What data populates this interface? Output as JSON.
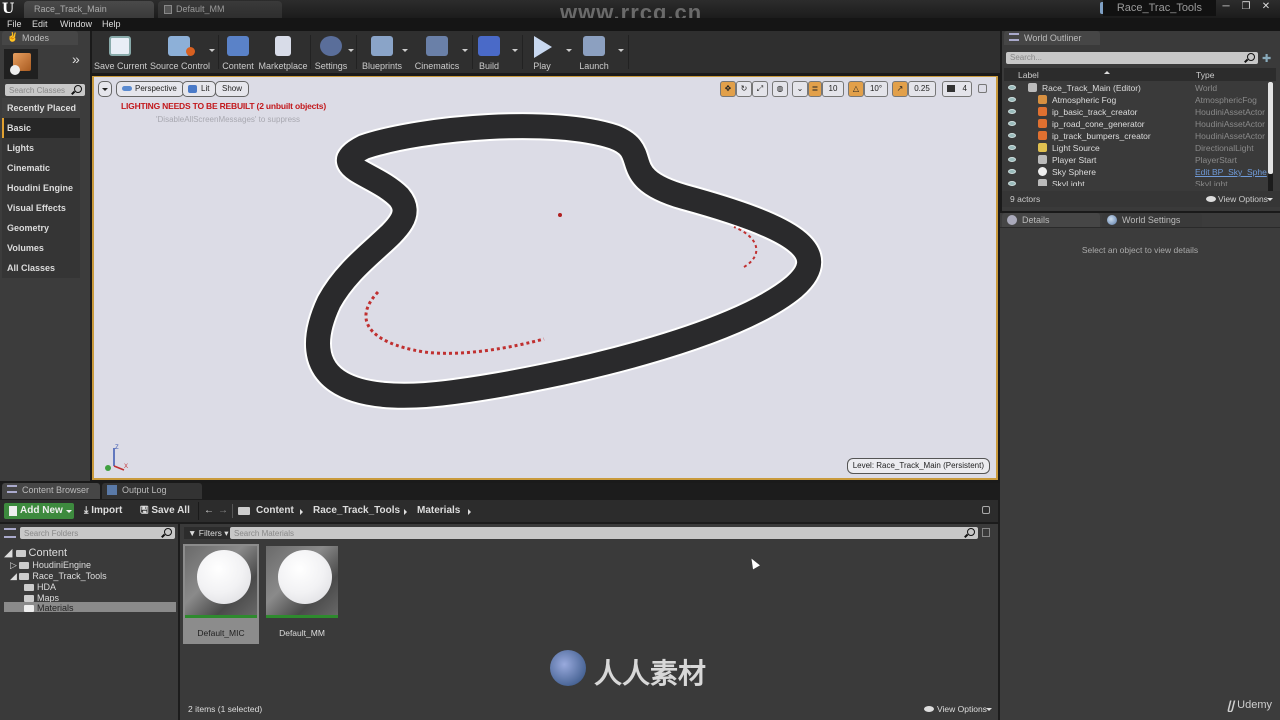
{
  "window": {
    "logo": "U",
    "tabs": [
      {
        "label": "Race_Track_Main",
        "active": true
      },
      {
        "label": "Default_MM",
        "active": false
      }
    ],
    "project_name": "Race_Trac_Tools",
    "controls": {
      "minimize": "─",
      "maximize": "❐",
      "close": "✕"
    }
  },
  "menu": [
    "File",
    "Edit",
    "Window",
    "Help"
  ],
  "modes": {
    "tab_label": "Modes",
    "expand_glyph": "»",
    "search_placeholder": "Search Classes",
    "categories": [
      "Recently Placed",
      "Basic",
      "Lights",
      "Cinematic",
      "Houdini Engine",
      "Visual Effects",
      "Geometry",
      "Volumes",
      "All Classes"
    ],
    "active_category": "Basic"
  },
  "toolbar": {
    "buttons": [
      {
        "label": "Save Current",
        "icon": "save-icon"
      },
      {
        "label": "Source Control",
        "icon": "source-control-icon"
      },
      {
        "label": "Content",
        "icon": "content-icon"
      },
      {
        "label": "Marketplace",
        "icon": "marketplace-icon"
      },
      {
        "label": "Settings",
        "icon": "settings-icon"
      },
      {
        "label": "Blueprints",
        "icon": "blueprints-icon"
      },
      {
        "label": "Cinematics",
        "icon": "cinematics-icon"
      },
      {
        "label": "Build",
        "icon": "build-icon"
      },
      {
        "label": "Play",
        "icon": "play-icon"
      },
      {
        "label": "Launch",
        "icon": "launch-icon"
      }
    ]
  },
  "viewport": {
    "perspective_label": "Perspective",
    "lit_label": "Lit",
    "show_label": "Show",
    "warning": "LIGHTING NEEDS TO BE REBUILT (2 unbuilt objects)",
    "hint": "'DisableAllScreenMessages' to suppress",
    "grid_snap": "10",
    "rotation_snap": "10°",
    "scale_snap": "0.25",
    "camera_speed": "4",
    "level_label": "Level:  Race_Track_Main (Persistent)",
    "axis": {
      "z": "Z",
      "x": "X",
      "y": "Y"
    },
    "accent_color": "#c99a3c",
    "warning_color": "#c2181c"
  },
  "outliner": {
    "tab_label": "World Outliner",
    "search_placeholder": "Search...",
    "col_label": "Label",
    "col_type": "Type",
    "rows": [
      {
        "label": "Race_Track_Main (Editor)",
        "type": "World",
        "icon": "world-icon",
        "indent": 0
      },
      {
        "label": "Atmospheric Fog",
        "type": "AtmosphericFog",
        "icon": "fog-icon",
        "indent": 1
      },
      {
        "label": "ip_basic_track_creator",
        "type": "HoudiniAssetActor",
        "icon": "houdini-icon",
        "indent": 1
      },
      {
        "label": "ip_road_cone_generator",
        "type": "HoudiniAssetActor",
        "icon": "houdini-icon",
        "indent": 1
      },
      {
        "label": "ip_track_bumpers_creator",
        "type": "HoudiniAssetActor",
        "icon": "houdini-icon",
        "indent": 1
      },
      {
        "label": "Light Source",
        "type": "DirectionalLight",
        "icon": "light-icon",
        "indent": 1
      },
      {
        "label": "Player Start",
        "type": "PlayerStart",
        "icon": "player-start-icon",
        "indent": 1
      },
      {
        "label": "Sky Sphere",
        "type": "Edit BP_Sky_Sphe",
        "icon": "sphere-icon",
        "indent": 1,
        "type_link": true
      },
      {
        "label": "SkyLight",
        "type": "SkyLight",
        "icon": "skylight-icon",
        "indent": 1
      }
    ],
    "actor_count": "9 actors",
    "view_options": "View Options"
  },
  "details": {
    "tab_details": "Details",
    "tab_world_settings": "World Settings",
    "empty_message": "Select an object to view details"
  },
  "content_browser": {
    "tab_label": "Content Browser",
    "output_log_label": "Output Log",
    "add_new": "Add New",
    "import": "Import",
    "save_all": "Save All",
    "breadcrumb": [
      "Content",
      "Race_Track_Tools",
      "Materials"
    ],
    "search_folders_placeholder": "Search Folders",
    "filters_label": "Filters",
    "search_assets_placeholder": "Search Materials",
    "tree": [
      {
        "label": "Content",
        "level": 0,
        "expanded": true
      },
      {
        "label": "HoudiniEngine",
        "level": 1,
        "expanded": false
      },
      {
        "label": "Race_Track_Tools",
        "level": 1,
        "expanded": true
      },
      {
        "label": "HDA",
        "level": 2
      },
      {
        "label": "Maps",
        "level": 2
      },
      {
        "label": "Materials",
        "level": 2,
        "selected": true
      }
    ],
    "assets": [
      {
        "name": "Default_MIC",
        "selected": true
      },
      {
        "name": "Default_MM",
        "selected": false
      }
    ],
    "status": "2 items (1 selected)",
    "view_options": "View Options"
  },
  "watermark": {
    "udemy": "Udemy",
    "site": "www.rrcg.cn",
    "brand": "人人素材"
  }
}
